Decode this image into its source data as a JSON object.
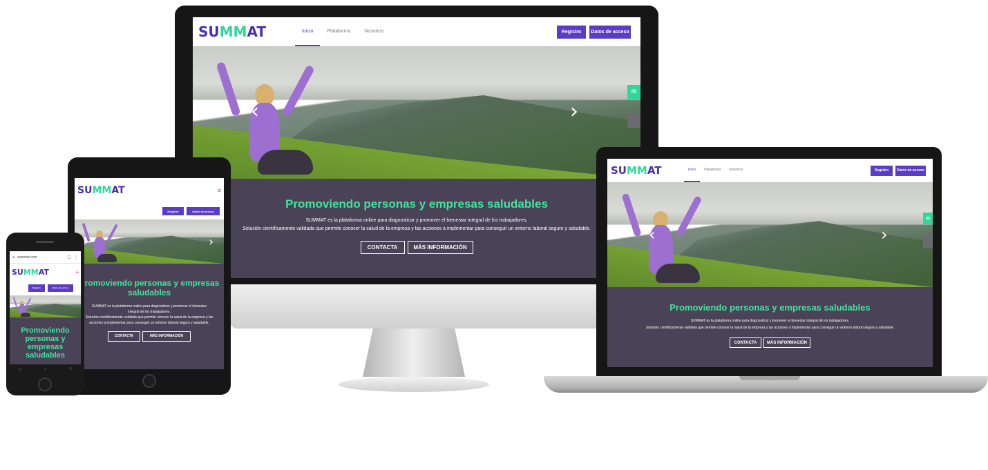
{
  "site": {
    "logo": {
      "prefix": "SU",
      "mark": "MM",
      "suffix": "AT"
    },
    "nav": [
      {
        "label": "Inicio",
        "active": true
      },
      {
        "label": "Plataforma",
        "active": false
      },
      {
        "label": "Nosotros",
        "active": false
      }
    ],
    "register_label": "Registro",
    "access_label": "Datos de acceso",
    "hero": {
      "prev_icon": "chevron-left-icon",
      "next_icon": "chevron-right-icon"
    },
    "headline": "Promoviendo personas y empresas saludables",
    "desc_line1": "SUMMAT es la plataforma online para diagnosticar y promover el bienestar integral de los trabajadores.",
    "desc_line2": "Solución científicamente validada que permite conocer la salud de la empresa y las acciones a implementar para conseguir un entorno laboral seguro y saludable.",
    "contact_label": "CONTACTA",
    "more_label": "MÁS INFORMACIÓN",
    "mail_icon": "mail-icon",
    "menu_icon": "hamburger-icon"
  },
  "phone": {
    "url": "summat.com"
  },
  "colors": {
    "brand": "#5b3cc4",
    "accent": "#2fd89a",
    "headline": "#3fe59c",
    "content_bg": "#4a4358"
  }
}
